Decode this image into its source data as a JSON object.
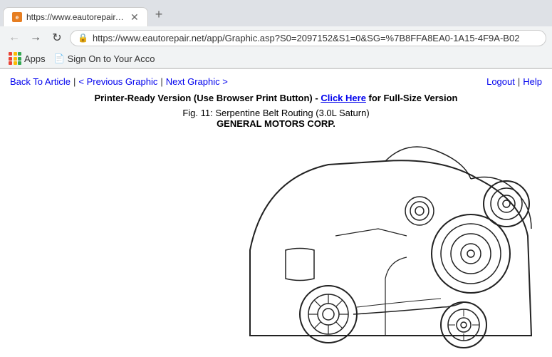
{
  "browser": {
    "url": "https://www.eautorepair.net/app/Graphic.asp?S0=2097152&S1=0&SG=%7B8FFA8EA0-1A15-4F9A-B02",
    "tab_title": "https://www.eautorepair.net/app...",
    "favicon_text": "e"
  },
  "bookmarks": {
    "apps_label": "Apps",
    "sign_on_label": "Sign On to Your Acco"
  },
  "page": {
    "back_to_article": "Back To Article",
    "previous_graphic": "< Previous Graphic",
    "next_graphic": "Next Graphic >",
    "logout": "Logout",
    "help": "Help",
    "separator": "|",
    "print_text_before": "Printer-Ready Version (Use Browser Print Button) - ",
    "click_here": "Click Here",
    "print_text_after": " for Full-Size Version",
    "figure_title": "Fig. 11: Serpentine Belt Routing (3.0L Saturn)",
    "corp_name": "GENERAL MOTORS CORP."
  },
  "icons": {
    "back": "←",
    "forward": "→",
    "refresh": "↻",
    "lock": "🔒",
    "apps_dots": [
      "#ea4335",
      "#fbbc04",
      "#34a853",
      "#ea4335",
      "#fbbc04",
      "#34a853",
      "#ea4335",
      "#fbbc04",
      "#34a853"
    ],
    "page": "📄"
  }
}
